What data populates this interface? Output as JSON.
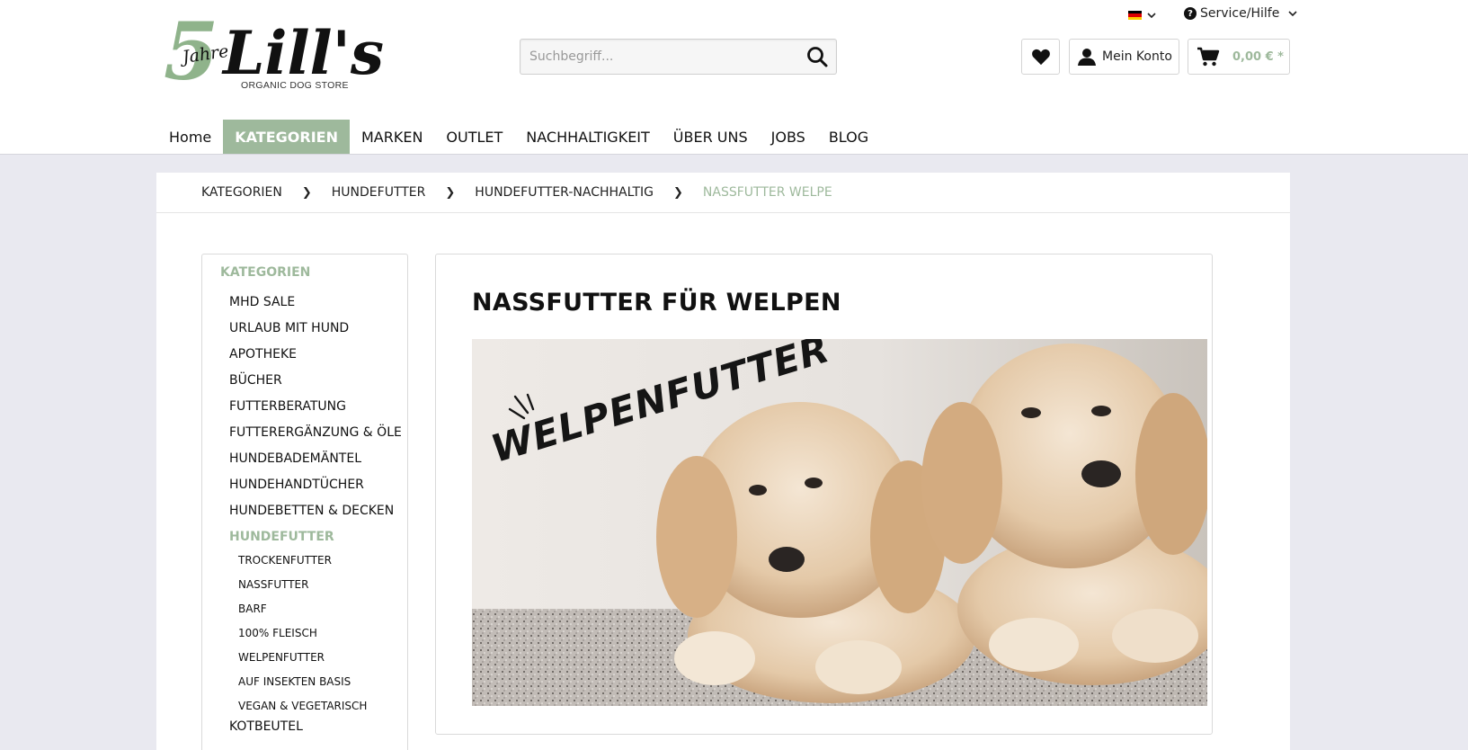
{
  "logo": {
    "years_number": "5",
    "years_word": "Jahre",
    "brand": "Lill's",
    "subtitle": "ORGANIC DOG STORE"
  },
  "topbar": {
    "language": "DE",
    "service_label": "Service/Hilfe"
  },
  "search": {
    "placeholder": "Suchbegriff..."
  },
  "account": {
    "label": "Mein Konto"
  },
  "cart": {
    "amount": "0,00 € *"
  },
  "nav": {
    "items": [
      "Home",
      "KATEGORIEN",
      "MARKEN",
      "OUTLET",
      "NACHHALTIGKEIT",
      "ÜBER UNS",
      "JOBS",
      "BLOG"
    ],
    "active_index": 1
  },
  "breadcrumb": [
    "KATEGORIEN",
    "HUNDEFUTTER",
    "HUNDEFUTTER-NACHHALTIG",
    "NASSFUTTER WELPE"
  ],
  "sidebar": {
    "title": "KATEGORIEN",
    "items": [
      "MHD SALE",
      "URLAUB MIT HUND",
      "APOTHEKE",
      "BÜCHER",
      "FUTTERBERATUNG",
      "FUTTERERGÄNZUNG & ÖLE",
      "HUNDEBADEMÄNTEL",
      "HUNDEHANDTÜCHER",
      "HUNDEBETTEN & DECKEN",
      "HUNDEFUTTER"
    ],
    "active_item": "HUNDEFUTTER",
    "subitems": [
      "TROCKENFUTTER",
      "NASSFUTTER",
      "BARF",
      "100% FLEISCH",
      "WELPENFUTTER",
      "AUF INSEKTEN BASIS",
      "VEGAN & VEGETARISCH"
    ],
    "after_item": "KOTBEUTEL"
  },
  "main": {
    "title": "NASSFUTTER FÜR WELPEN",
    "hero_text": "WELPENFUTTER"
  },
  "colors": {
    "accent": "#9eb99c",
    "page_bg": "#e9e9f0"
  }
}
